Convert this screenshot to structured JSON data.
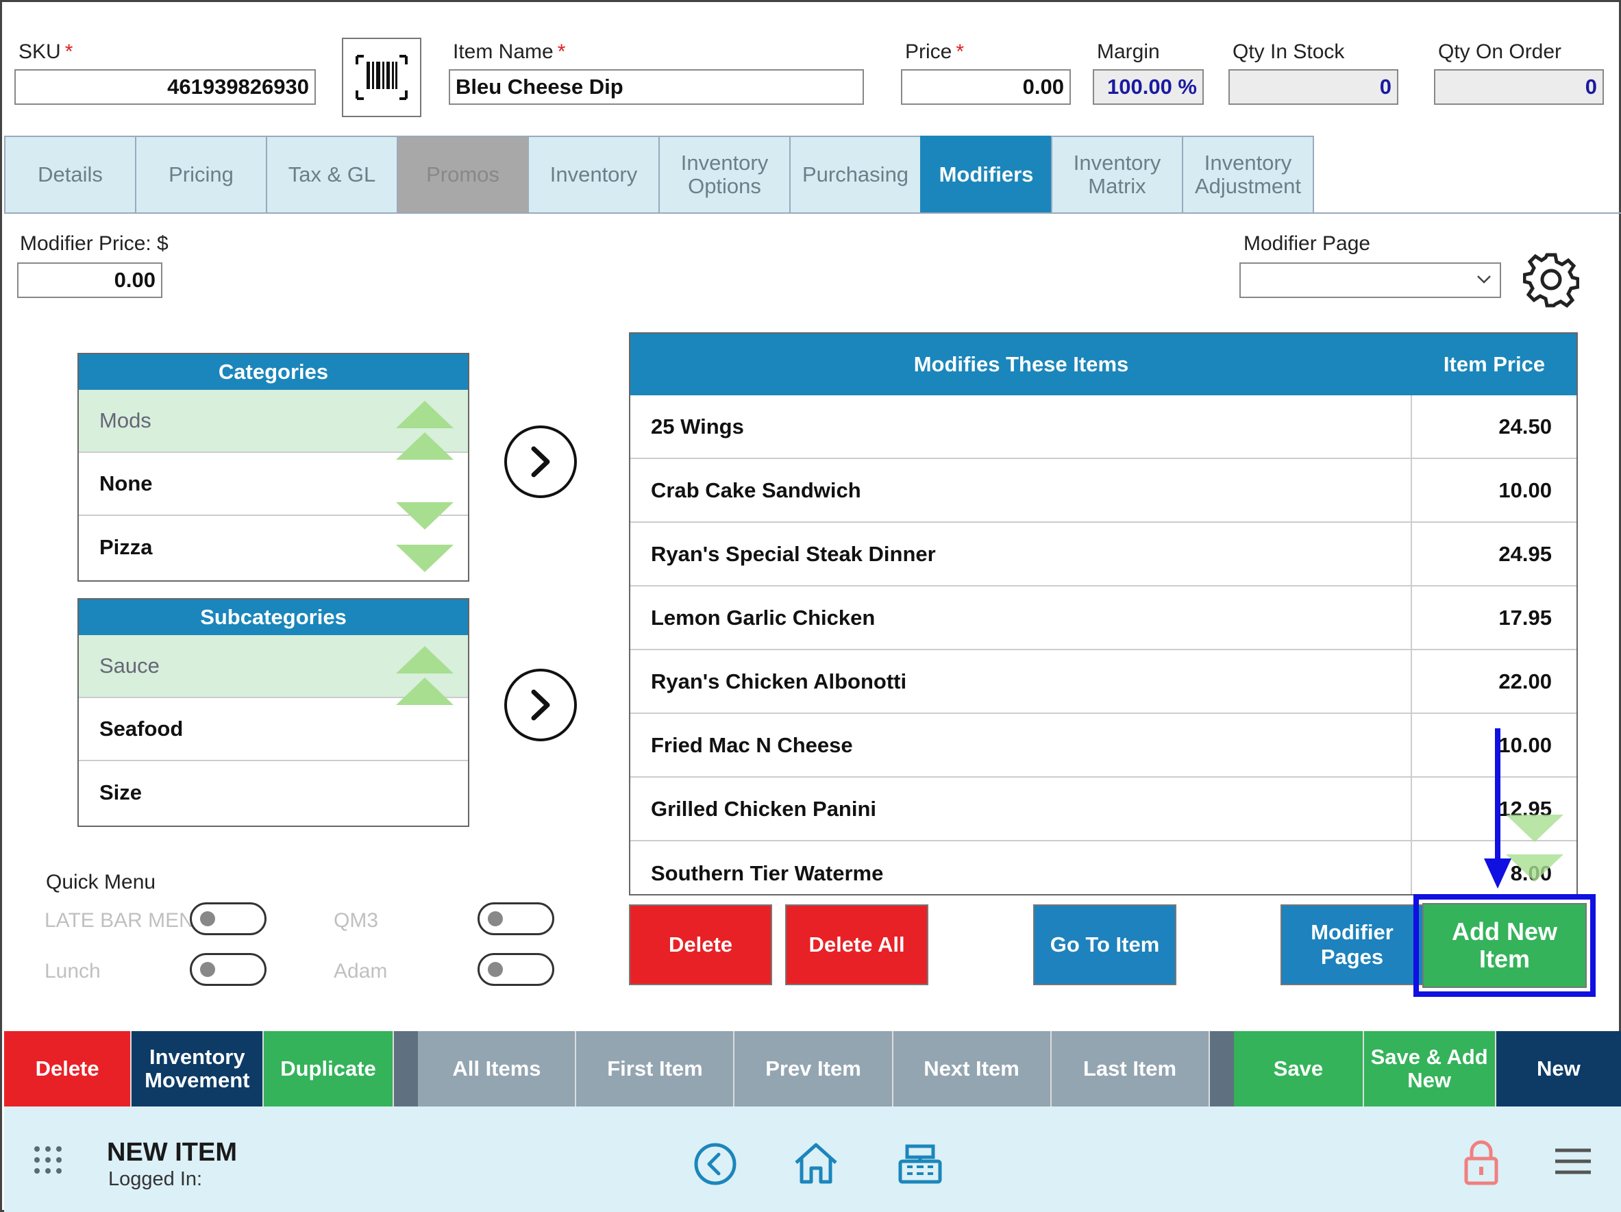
{
  "header": {
    "sku_label": "SKU",
    "sku_value": "461939826930",
    "item_name_label": "Item Name",
    "item_name_value": "Bleu Cheese Dip",
    "price_label": "Price",
    "price_value": "0.00",
    "margin_label": "Margin",
    "margin_value": "100.00 %",
    "qty_in_stock_label": "Qty In Stock",
    "qty_in_stock_value": "0",
    "qty_on_order_label": "Qty On Order",
    "qty_on_order_value": "0",
    "required_mark": "*"
  },
  "tabs": [
    {
      "label": "Details",
      "state": "normal"
    },
    {
      "label": "Pricing",
      "state": "normal"
    },
    {
      "label": "Tax & GL",
      "state": "normal"
    },
    {
      "label": "Promos",
      "state": "disabled"
    },
    {
      "label": "Inventory",
      "state": "normal"
    },
    {
      "label": "Inventory Options",
      "state": "normal"
    },
    {
      "label": "Purchasing",
      "state": "normal"
    },
    {
      "label": "Modifiers",
      "state": "active"
    },
    {
      "label": "Inventory Matrix",
      "state": "normal"
    },
    {
      "label": "Inventory Adjustment",
      "state": "normal"
    }
  ],
  "modifier": {
    "price_label": "Modifier Price: $",
    "price_value": "0.00",
    "page_label": "Modifier Page",
    "page_value": ""
  },
  "categories": {
    "title": "Categories",
    "items": [
      {
        "label": "Mods",
        "selected": true
      },
      {
        "label": "None",
        "selected": false
      },
      {
        "label": "Pizza",
        "selected": false
      }
    ]
  },
  "subcategories": {
    "title": "Subcategories",
    "items": [
      {
        "label": "Sauce",
        "selected": true
      },
      {
        "label": "Seafood",
        "selected": false
      },
      {
        "label": "Size",
        "selected": false
      }
    ]
  },
  "modifies_table": {
    "header_item": "Modifies These Items",
    "header_price": "Item Price",
    "rows": [
      {
        "name": "25 Wings",
        "price": "24.50"
      },
      {
        "name": "Crab Cake Sandwich",
        "price": "10.00"
      },
      {
        "name": "Ryan's Special Steak Dinner",
        "price": "24.95"
      },
      {
        "name": "Lemon Garlic Chicken",
        "price": "17.95"
      },
      {
        "name": "Ryan's Chicken Albonotti",
        "price": "22.00"
      },
      {
        "name": "Fried Mac N Cheese",
        "price": "10.00"
      },
      {
        "name": "Grilled Chicken Panini",
        "price": "12.95"
      },
      {
        "name": "Southern Tier Waterme",
        "price": "8.00"
      }
    ]
  },
  "table_buttons": {
    "delete": "Delete",
    "delete_all": "Delete All",
    "go_to_item": "Go To Item",
    "modifier_pages": "Modifier Pages",
    "add_new_item": "Add New Item"
  },
  "quick_menu": {
    "title": "Quick Menu",
    "items": [
      "LATE BAR MENU",
      "QM3",
      "Lunch",
      "Adam"
    ]
  },
  "action_bar": {
    "delete": "Delete",
    "inventory_movement": "Inventory Movement",
    "duplicate": "Duplicate",
    "all_items": "All Items",
    "first_item": "First Item",
    "prev_item": "Prev Item",
    "next_item": "Next Item",
    "last_item": "Last Item",
    "save": "Save",
    "save_add_new": "Save & Add New",
    "new": "New"
  },
  "footer": {
    "title": "NEW ITEM",
    "logged_in": "Logged In:"
  },
  "colors": {
    "primary_blue": "#1b86bb",
    "danger_red": "#e82127",
    "success_green": "#34b35a",
    "dark_navy": "#0d3b66",
    "highlight_blue": "#1010e0"
  }
}
